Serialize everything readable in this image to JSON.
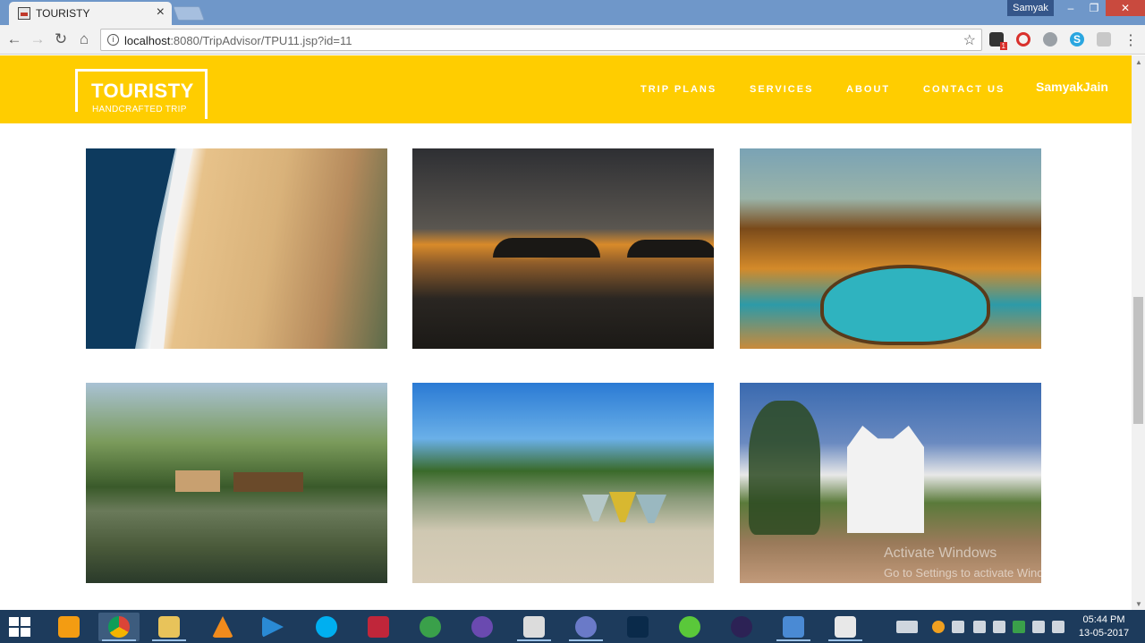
{
  "browser": {
    "tab_title": "TOURISTY",
    "tab_close": "×",
    "profile_name": "Samyak",
    "window_controls": {
      "minimize": "–",
      "restore": "❐",
      "close": "✕"
    },
    "url_host": "localhost",
    "url_rest": ":8080/TripAdvisor/TPU11.jsp?id=11",
    "extension_badge": "1",
    "extensions": [
      "ghostery-icon",
      "opera-icon",
      "sync-icon",
      "skype-icon",
      "pdf-icon"
    ]
  },
  "site": {
    "logo_title": "TOURISTY",
    "logo_subtitle": "HANDCRAFTED TRIP",
    "nav": [
      "TRIP PLANS",
      "SERVICES",
      "ABOUT",
      "CONTACT US"
    ],
    "user_name": "SamyakJain",
    "accent_color": "#ffcd00"
  },
  "gallery": {
    "images": [
      "beach-crowd",
      "sunset-island",
      "resort-pool",
      "backwater-houseboat",
      "beach-boats",
      "white-church"
    ]
  },
  "watermark": {
    "title": "Activate Windows",
    "subtitle": "Go to Settings to activate Windows."
  },
  "taskbar": {
    "apps": [
      "file-manager",
      "chrome",
      "explorer",
      "vlc",
      "media-player",
      "skype",
      "screen-recorder",
      "internet-download-manager",
      "browser-app",
      "notepad",
      "dolphin",
      "me-app",
      "music-app",
      "eclipse",
      "photos",
      "java"
    ],
    "time": "05:44 PM",
    "date": "13-05-2017"
  }
}
